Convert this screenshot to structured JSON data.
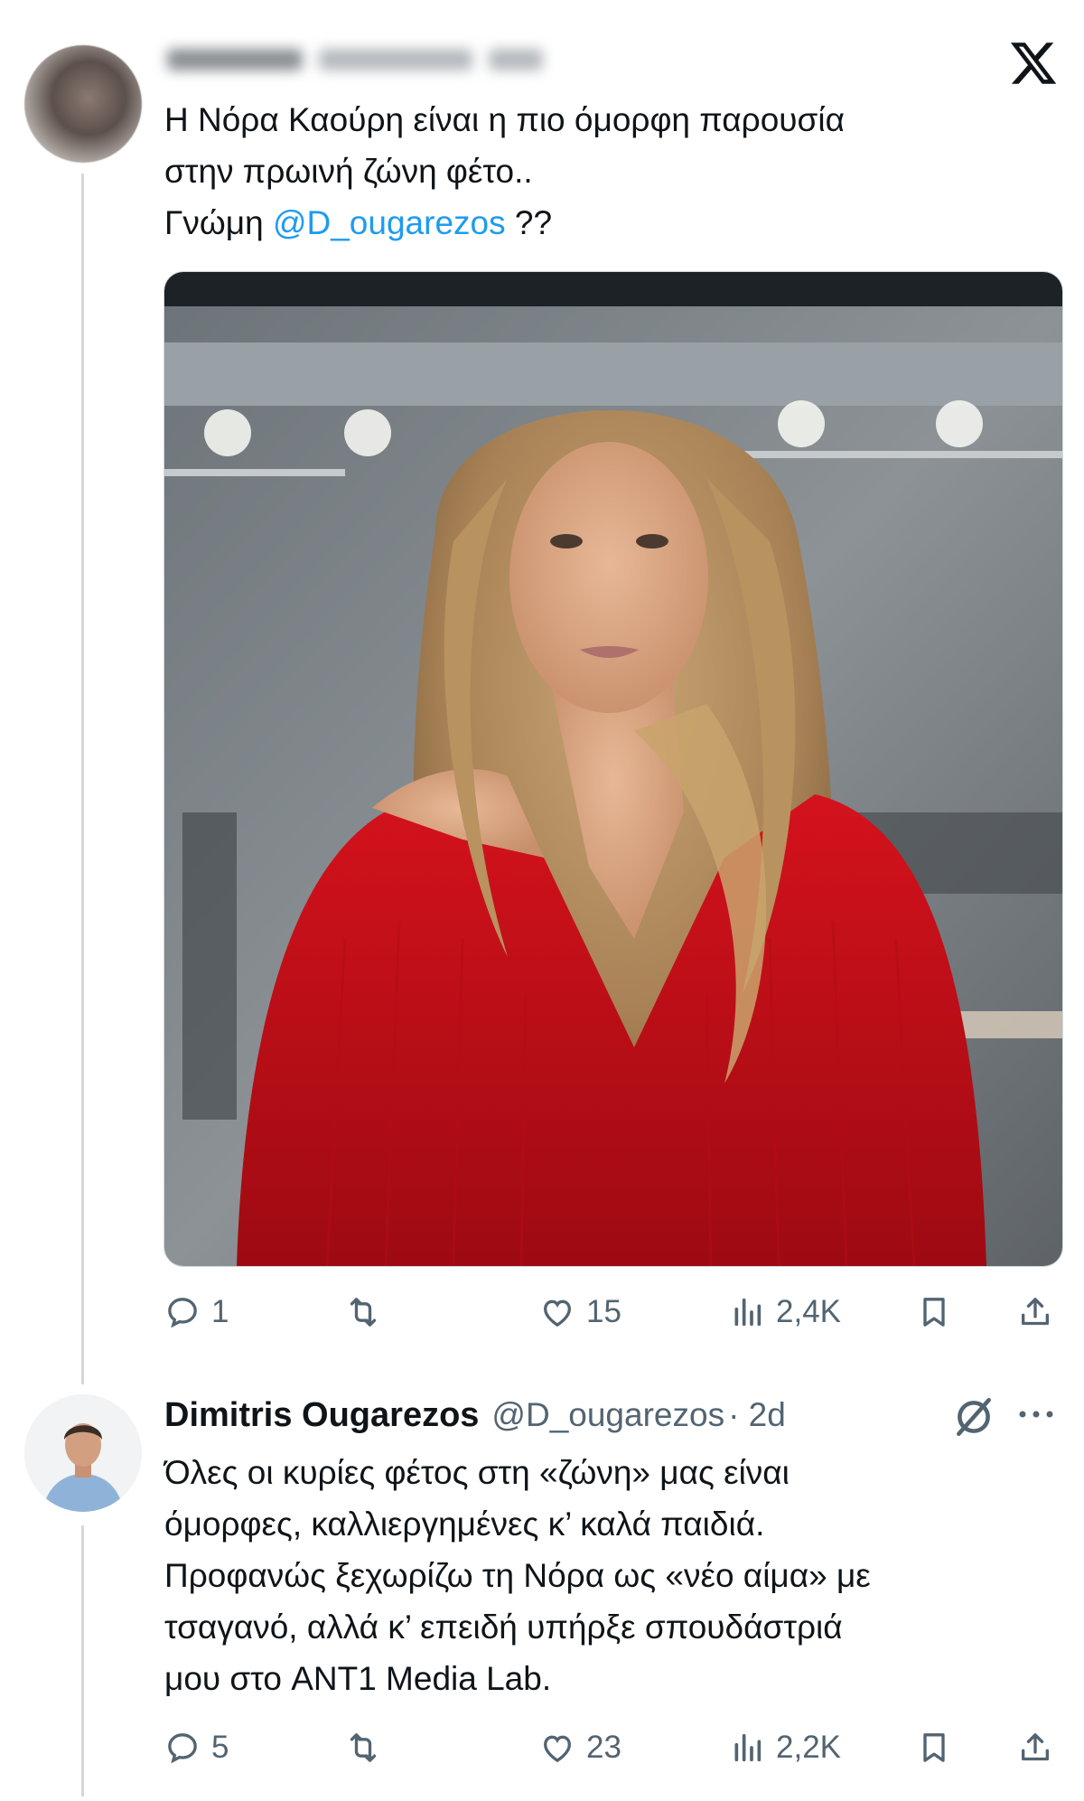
{
  "post": {
    "text_lines": [
      "Η Νόρα Καούρη είναι η πιο όμορφη παρουσία",
      "στην πρωινή ζώνη φέτο..",
      "Γνώμη "
    ],
    "mention": "@D_ougarezos",
    "mention_suffix": " ??",
    "stats": {
      "replies": "1",
      "likes": "15",
      "views": "2,4K"
    }
  },
  "reply": {
    "name": "Dimitris Ougarezos",
    "handle": "@D_ougarezos",
    "time": "· 2d",
    "text_lines": [
      "Όλες οι κυρίες φέτος στη «ζώνη» μας είναι",
      "όμορφες, καλλιεργημένες κ’ καλά παιδιά.",
      "Προφανώς ξεχωρίζω τη Νόρα ως «νέο αίμα» με",
      "τσαγανό, αλλά κ’ επειδή υπήρξε σπουδάστριά",
      "μου στο ANT1 Media Lab."
    ],
    "stats": {
      "replies": "5",
      "likes": "23",
      "views": "2,2K"
    }
  },
  "icons": {
    "brand": "x-logo-icon",
    "reply": "reply-icon",
    "retweet": "retweet-icon",
    "like": "heart-icon",
    "views": "views-icon",
    "bookmark": "bookmark-icon",
    "share": "share-icon",
    "more": "more-icon"
  },
  "colors": {
    "accent": "#1d9bf0",
    "text": "#0f1419",
    "muted": "#536471",
    "thread_line": "#cfd9de"
  }
}
